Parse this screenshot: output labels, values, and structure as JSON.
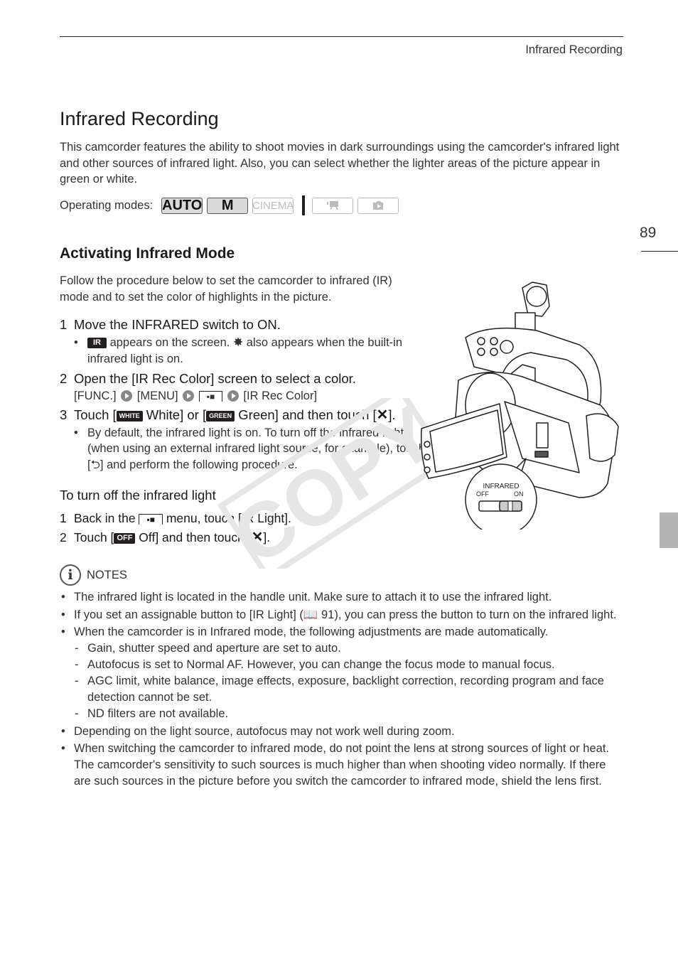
{
  "header": {
    "running_head": "Infrared Recording",
    "page_number": "89"
  },
  "title": "Infrared Recording",
  "intro": "This camcorder features the ability to shoot movies in dark surroundings using the camcorder's infrared light and other sources of infrared light. Also, you can select whether the lighter areas of the picture appear in green or white.",
  "operating_modes": {
    "label": "Operating modes:",
    "modes": [
      {
        "name": "AUTO",
        "active": true
      },
      {
        "name": "M",
        "active": true
      },
      {
        "name": "CINEMA",
        "active": false
      },
      {
        "name": "movie-mode-icon",
        "active": false
      },
      {
        "name": "photo-mode-icon",
        "active": false
      }
    ]
  },
  "section": {
    "title": "Activating Infrared Mode",
    "intro": "Follow the procedure below to set the camcorder to infrared (IR) mode and to set the color of highlights in the picture.",
    "steps": [
      {
        "num": "1",
        "text": "Move the INFRARED switch to ON.",
        "bullet": {
          "icon": "IR",
          "text_a": " appears on the screen. ",
          "text_b": " also appears when the built-in infrared light is on."
        }
      },
      {
        "num": "2",
        "text": "Open the [IR Rec Color] screen to select a color.",
        "path": {
          "func": "[FUNC.]",
          "menu": "[MENU]",
          "target": "[IR Rec Color]"
        }
      },
      {
        "num": "3",
        "text_a": "Touch [",
        "white_icon": "WHITE",
        "text_b": " White] or [",
        "green_icon": "GREEN",
        "text_c": " Green] and then touch [",
        "text_d": "].",
        "close_symbol": "✕",
        "bullet": {
          "text_a": "By default, the infrared light is on. To turn off the infrared light (when using an external infrared light source, for example), touch [",
          "return_symbol": "⮌",
          "text_b": "] and perform the following procedure."
        }
      }
    ],
    "subsection": {
      "title": "To turn off the infrared light",
      "steps": [
        {
          "num": "1",
          "text_a": "Back in the ",
          "text_b": " menu, touch [IR Light]."
        },
        {
          "num": "2",
          "text_a": "Touch [",
          "off_icon": "OFF",
          "text_b": " Off] and then touch [",
          "close_symbol": "✕",
          "text_c": "]."
        }
      ]
    }
  },
  "figure": {
    "switch_label": "INFRARED",
    "off_label": "OFF",
    "on_label": "ON",
    "switch_position": "ON"
  },
  "watermark": "COPY",
  "notes": {
    "label": "NOTES",
    "items": [
      {
        "text": "The infrared light is located in the handle unit. Make sure to attach it to use the infrared light."
      },
      {
        "text": "If you set an assignable button to [IR Light] (📖 91), you can press the button to turn on the infrared light."
      },
      {
        "text": "When the camcorder is in Infrared mode, the following adjustments are made automatically.",
        "subitems": [
          "Gain, shutter speed and aperture are set to auto.",
          "Autofocus is set to Normal AF. However, you can change the focus mode to manual focus.",
          "AGC limit, white balance, image effects, exposure, backlight correction, recording program and face detection cannot be set.",
          "ND filters are not available."
        ]
      },
      {
        "text": "Depending on the light source, autofocus may not work well during zoom."
      },
      {
        "text": "When switching the camcorder to infrared mode, do not point the lens at strong sources of light or heat. The camcorder's sensitivity to such sources is much higher than when shooting video normally. If there are such sources in the picture before you switch the camcorder to infrared mode, shield the lens first."
      }
    ]
  },
  "colors": {
    "text": "#231f20",
    "thumb_tab": "#b3b3b3",
    "watermark": "#e6e6e6"
  }
}
